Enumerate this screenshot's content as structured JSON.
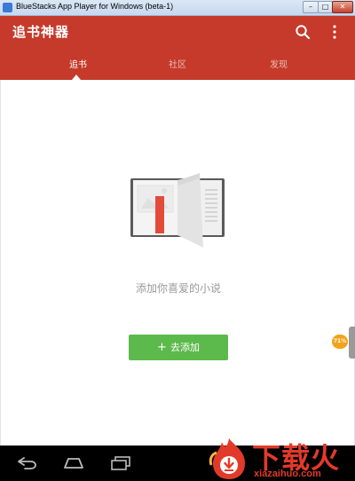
{
  "window": {
    "title": "BlueStacks App Player for Windows (beta-1)",
    "min_glyph": "–",
    "max_glyph": "□",
    "close_glyph": "✕"
  },
  "app": {
    "title": "追书神器",
    "accent_color": "#c53a2a",
    "tabs": [
      {
        "label": "追书",
        "active": true
      },
      {
        "label": "社区",
        "active": false
      },
      {
        "label": "发现",
        "active": false
      }
    ]
  },
  "empty_state": {
    "message": "添加你喜爱的小说",
    "button_label": "去添加",
    "button_color": "#5cb94b"
  },
  "side_widget": {
    "badge": "71%"
  },
  "icons": {
    "search": "search-icon",
    "more": "more-vertical-icon",
    "back": "back-icon",
    "home": "home-icon",
    "recent": "recent-apps-icon"
  },
  "watermark": {
    "text": "下载火",
    "domain": "xiazaihuo.com"
  }
}
